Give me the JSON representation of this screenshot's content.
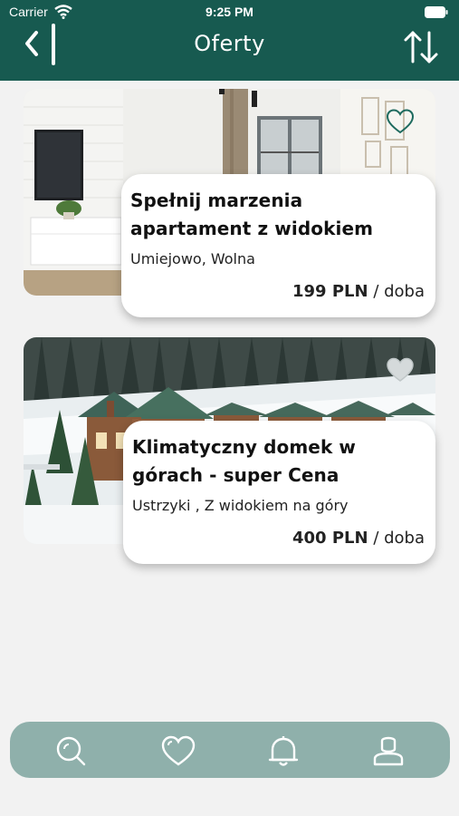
{
  "status_bar": {
    "carrier": "Carrier",
    "time": "9:25 PM"
  },
  "header": {
    "title": "Oferty",
    "back_icon": "back-icon",
    "sort_icon": "sort-arrows-icon"
  },
  "listings": [
    {
      "title": "Spełnij marzenia apartament z widokiem",
      "location": "Umiejowo, Wolna",
      "price": "199 PLN",
      "unit": "/ doba",
      "favorite": false
    },
    {
      "title": "Klimatyczny domek w górach - super Cena",
      "location": "Ustrzyki , Z widokiem na góry",
      "price": "400 PLN",
      "unit": "/ doba",
      "favorite": false
    }
  ],
  "tab_bar": {
    "items": [
      "search-icon",
      "heart-icon",
      "bell-icon",
      "user-icon"
    ]
  },
  "colors": {
    "header": "#175a50",
    "tab_bar": "#8fb0ab",
    "background": "#f2f2f2"
  }
}
